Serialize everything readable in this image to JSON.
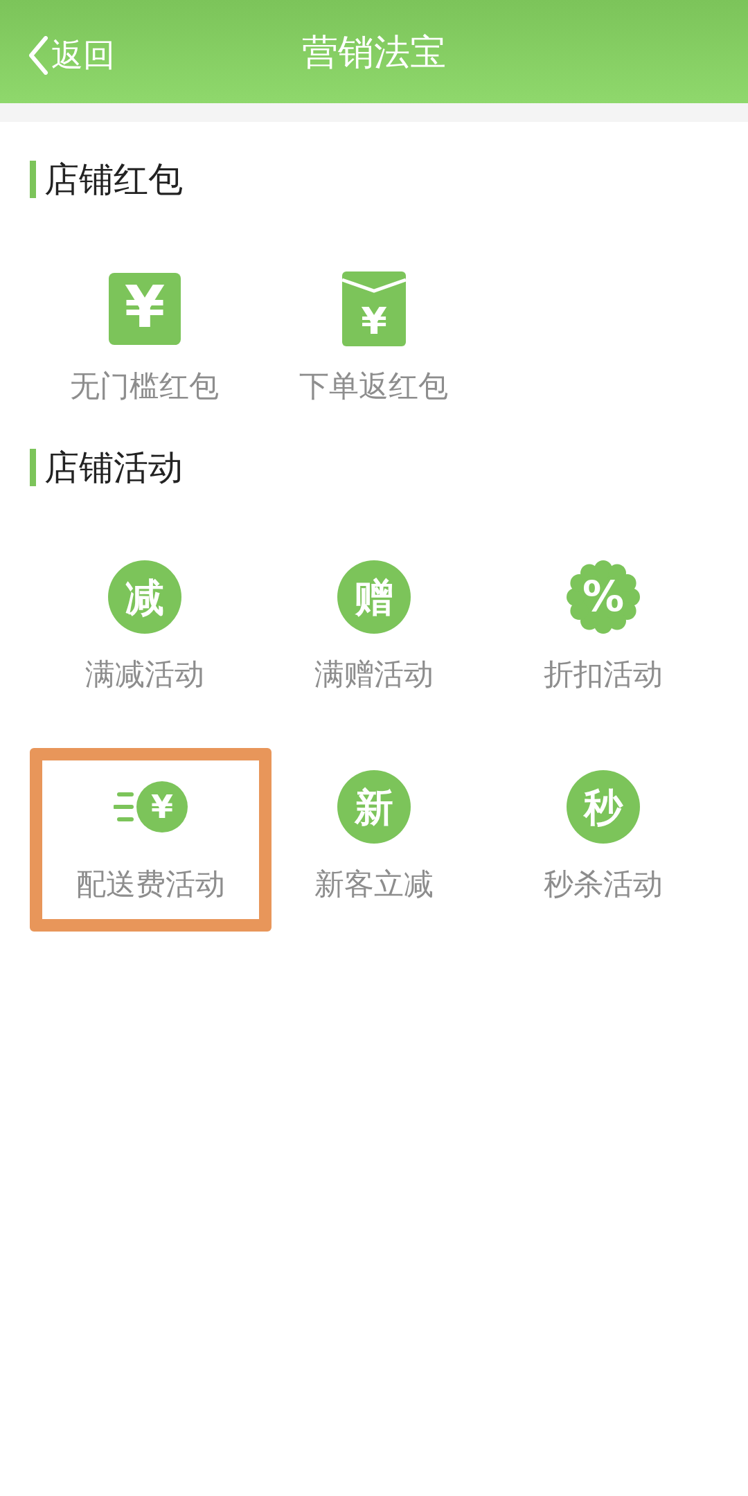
{
  "header": {
    "back": "返回",
    "title": "营销法宝"
  },
  "sections": [
    {
      "title": "店铺红包",
      "items": [
        {
          "kind": "tile",
          "glyph": "¥",
          "label": "无门槛红包",
          "highlighted": false
        },
        {
          "kind": "envelope",
          "glyph": "¥",
          "label": "下单返红包",
          "highlighted": false
        }
      ]
    },
    {
      "title": "店铺活动",
      "items": [
        {
          "kind": "circle",
          "glyph": "减",
          "label": "满减活动",
          "highlighted": false
        },
        {
          "kind": "circle",
          "glyph": "赠",
          "label": "满赠活动",
          "highlighted": false
        },
        {
          "kind": "scallop",
          "glyph": "%",
          "label": "折扣活动",
          "highlighted": false
        },
        {
          "kind": "delivery",
          "glyph": "¥",
          "label": "配送费活动",
          "highlighted": true
        },
        {
          "kind": "circle",
          "glyph": "新",
          "label": "新客立减",
          "highlighted": false
        },
        {
          "kind": "circle",
          "glyph": "秒",
          "label": "秒杀活动",
          "highlighted": false
        }
      ]
    }
  ]
}
